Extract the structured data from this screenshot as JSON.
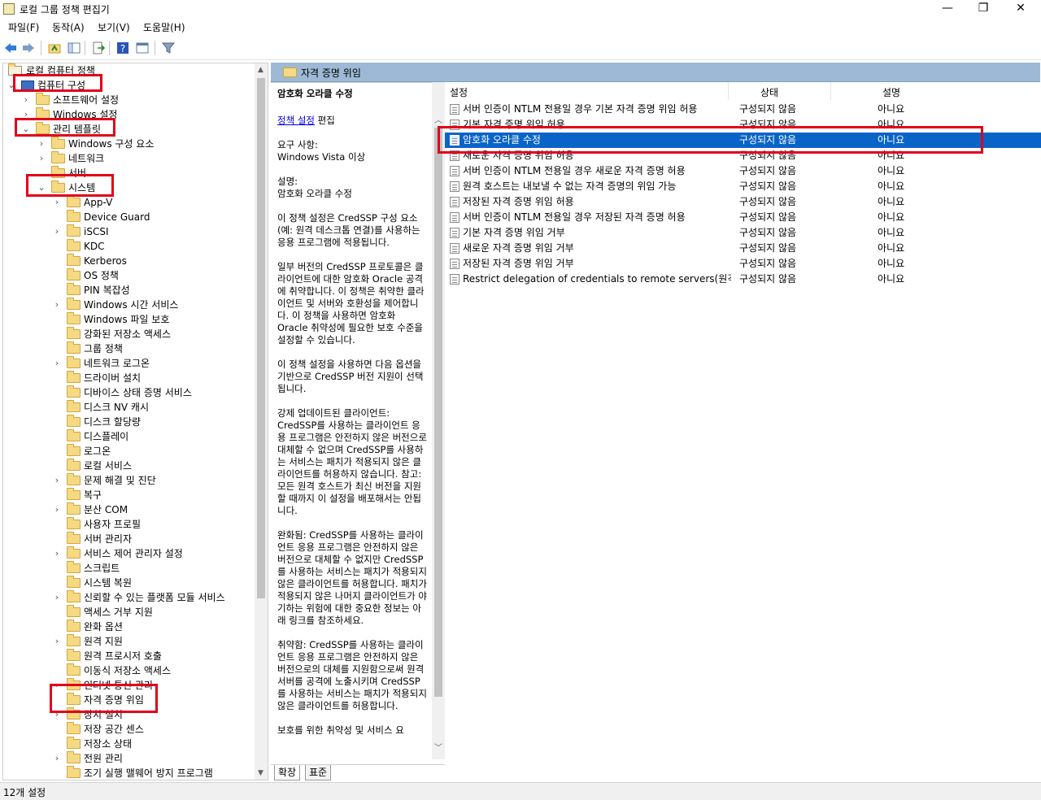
{
  "window": {
    "title": "로컬 그룹 정책 편집기",
    "minimize": "—",
    "maximize": "❐",
    "close": "✕"
  },
  "menu": [
    "파일(F)",
    "동작(A)",
    "보기(V)",
    "도움말(H)"
  ],
  "tree": {
    "root": "로컬 컴퓨터 정책",
    "computer_config": "컴퓨터 구성",
    "software_settings": "소프트웨어 설정",
    "windows_settings": "Windows 설정",
    "admin_templates": "관리 템플릿",
    "windows_components": "Windows 구성 요소",
    "network": "네트워크",
    "server": "서버",
    "system": "시스템",
    "system_children": [
      "App-V",
      "Device Guard",
      "iSCSI",
      "KDC",
      "Kerberos",
      "OS 정책",
      "PIN 복잡성",
      "Windows 시간 서비스",
      "Windows 파일 보호",
      "강화된 저장소 액세스",
      "그룹 정책",
      "네트워크 로그온",
      "드라이버 설치",
      "디바이스 상태 증명 서비스",
      "디스크 NV 캐시",
      "디스크 할당량",
      "디스플레이",
      "로그온",
      "로컬 서비스",
      "문제 해결 및 진단",
      "복구",
      "분산 COM",
      "사용자 프로필",
      "서버 관리자",
      "서비스 제어 관리자 설정",
      "스크립트",
      "시스템 복원",
      "신뢰할 수 있는 플랫폼 모듈 서비스",
      "액세스 거부 지원",
      "완화 옵션",
      "원격 지원",
      "원격 프로시저 호출",
      "이동식 저장소 액세스",
      "인터넷 통신 관리",
      "자격 증명 위임",
      "장치 설치",
      "저장 공간 센스",
      "저장소 상태",
      "전원 관리",
      "조기 실행 맬웨어 방지 프로그램"
    ]
  },
  "pane_header": "자격 증명 위임",
  "description": {
    "heading": "암호화 오라클 수정",
    "edit_link": "정책 설정",
    "edit_suffix": " 편집",
    "req_label": "요구 사항:",
    "req_value": "Windows Vista 이상",
    "desc_label": "설명:",
    "desc_value": "암호화 오라클 수정",
    "p1": "이 정책 설정은 CredSSP 구성 요소(예: 원격 데스크톱 연결)를 사용하는 응용 프로그램에 적용됩니다.",
    "p2": "일부 버전의 CredSSP 프로토콜은 클라이언트에 대한 암호화 Oracle 공격에 취약합니다. 이 정책은 취약한 클라이언트 및 서버와 호환성을 제어합니다. 이 정책을 사용하면 암호화 Oracle 취약성에 필요한 보호 수준을 설정할 수 있습니다.",
    "p3": "이 정책 설정을 사용하면 다음 옵션을 기반으로 CredSSP 버전 지원이 선택됩니다.",
    "p4": "강제 업데이트된 클라이언트: CredSSP를 사용하는 클라이언트 응용 프로그램은 안전하지 않은 버전으로 대체할 수 없으며 CredSSP를 사용하는 서비스는 패치가 적용되지 않은 클라이언트를 허용하지 않습니다. 참고: 모든 원격 호스트가 최신 버전을 지원할 때까지 이 설정을 배포해서는 안됩니다.",
    "p5": "완화됨: CredSSP를 사용하는 클라이언트 응용 프로그램은 안전하지 않은 버전으로 대체할 수 없지만 CredSSP를 사용하는 서비스는 패치가 적용되지 않은 클라이언트를 허용합니다. 패치가 적용되지 않은 나머지 클라이언트가 야기하는 위험에 대한 중요한 정보는 아래 링크를 참조하세요.",
    "p6": "취약함: CredSSP를 사용하는 클라이언트 응용 프로그램은 안전하지 않은 버전으로의 대체를 지원함으로써 원격 서버를 공격에 노출시키며 CredSSP를 사용하는 서비스는 패치가 적용되지 않은 클라이언트를 허용합니다.",
    "p7": "보호를 위한 취약성 및 서비스 요"
  },
  "tabs": [
    "확장",
    "표준"
  ],
  "list": {
    "headers": [
      "설정",
      "상태",
      "설명"
    ],
    "rows": [
      {
        "name": "서버 인증이 NTLM 전용일 경우 기본 자격 증명 위임 허용",
        "state": "구성되지 않음",
        "comment": "아니요"
      },
      {
        "name": "기본 자격 증명 위임 허용",
        "state": "구성되지 않음",
        "comment": "아니요"
      },
      {
        "name": "암호화 오라클 수정",
        "state": "구성되지 않음",
        "comment": "아니요"
      },
      {
        "name": "새로운 자격 증명 위임 허용",
        "state": "구성되지 않음",
        "comment": "아니요"
      },
      {
        "name": "서버 인증이 NTLM 전용일 경우 새로운 자격 증명 허용",
        "state": "구성되지 않음",
        "comment": "아니요"
      },
      {
        "name": "원격 호스트는 내보낼 수 없는 자격 증명의 위임 가능",
        "state": "구성되지 않음",
        "comment": "아니요"
      },
      {
        "name": "저장된 자격 증명 위임 허용",
        "state": "구성되지 않음",
        "comment": "아니요"
      },
      {
        "name": "서버 인증이 NTLM 전용일 경우 저장된 자격 증명 허용",
        "state": "구성되지 않음",
        "comment": "아니요"
      },
      {
        "name": "기본 자격 증명 위임 거부",
        "state": "구성되지 않음",
        "comment": "아니요"
      },
      {
        "name": "새로운 자격 증명 위임 거부",
        "state": "구성되지 않음",
        "comment": "아니요"
      },
      {
        "name": "저장된 자격 증명 위임 거부",
        "state": "구성되지 않음",
        "comment": "아니요"
      },
      {
        "name": "Restrict delegation of credentials to remote servers(원격 서...",
        "state": "구성되지 않음",
        "comment": "아니요"
      }
    ]
  },
  "status": "12개 설정",
  "colors": {
    "highlight": "#e3001b",
    "selection": "#0a64c8",
    "header": "#9db9d5"
  }
}
